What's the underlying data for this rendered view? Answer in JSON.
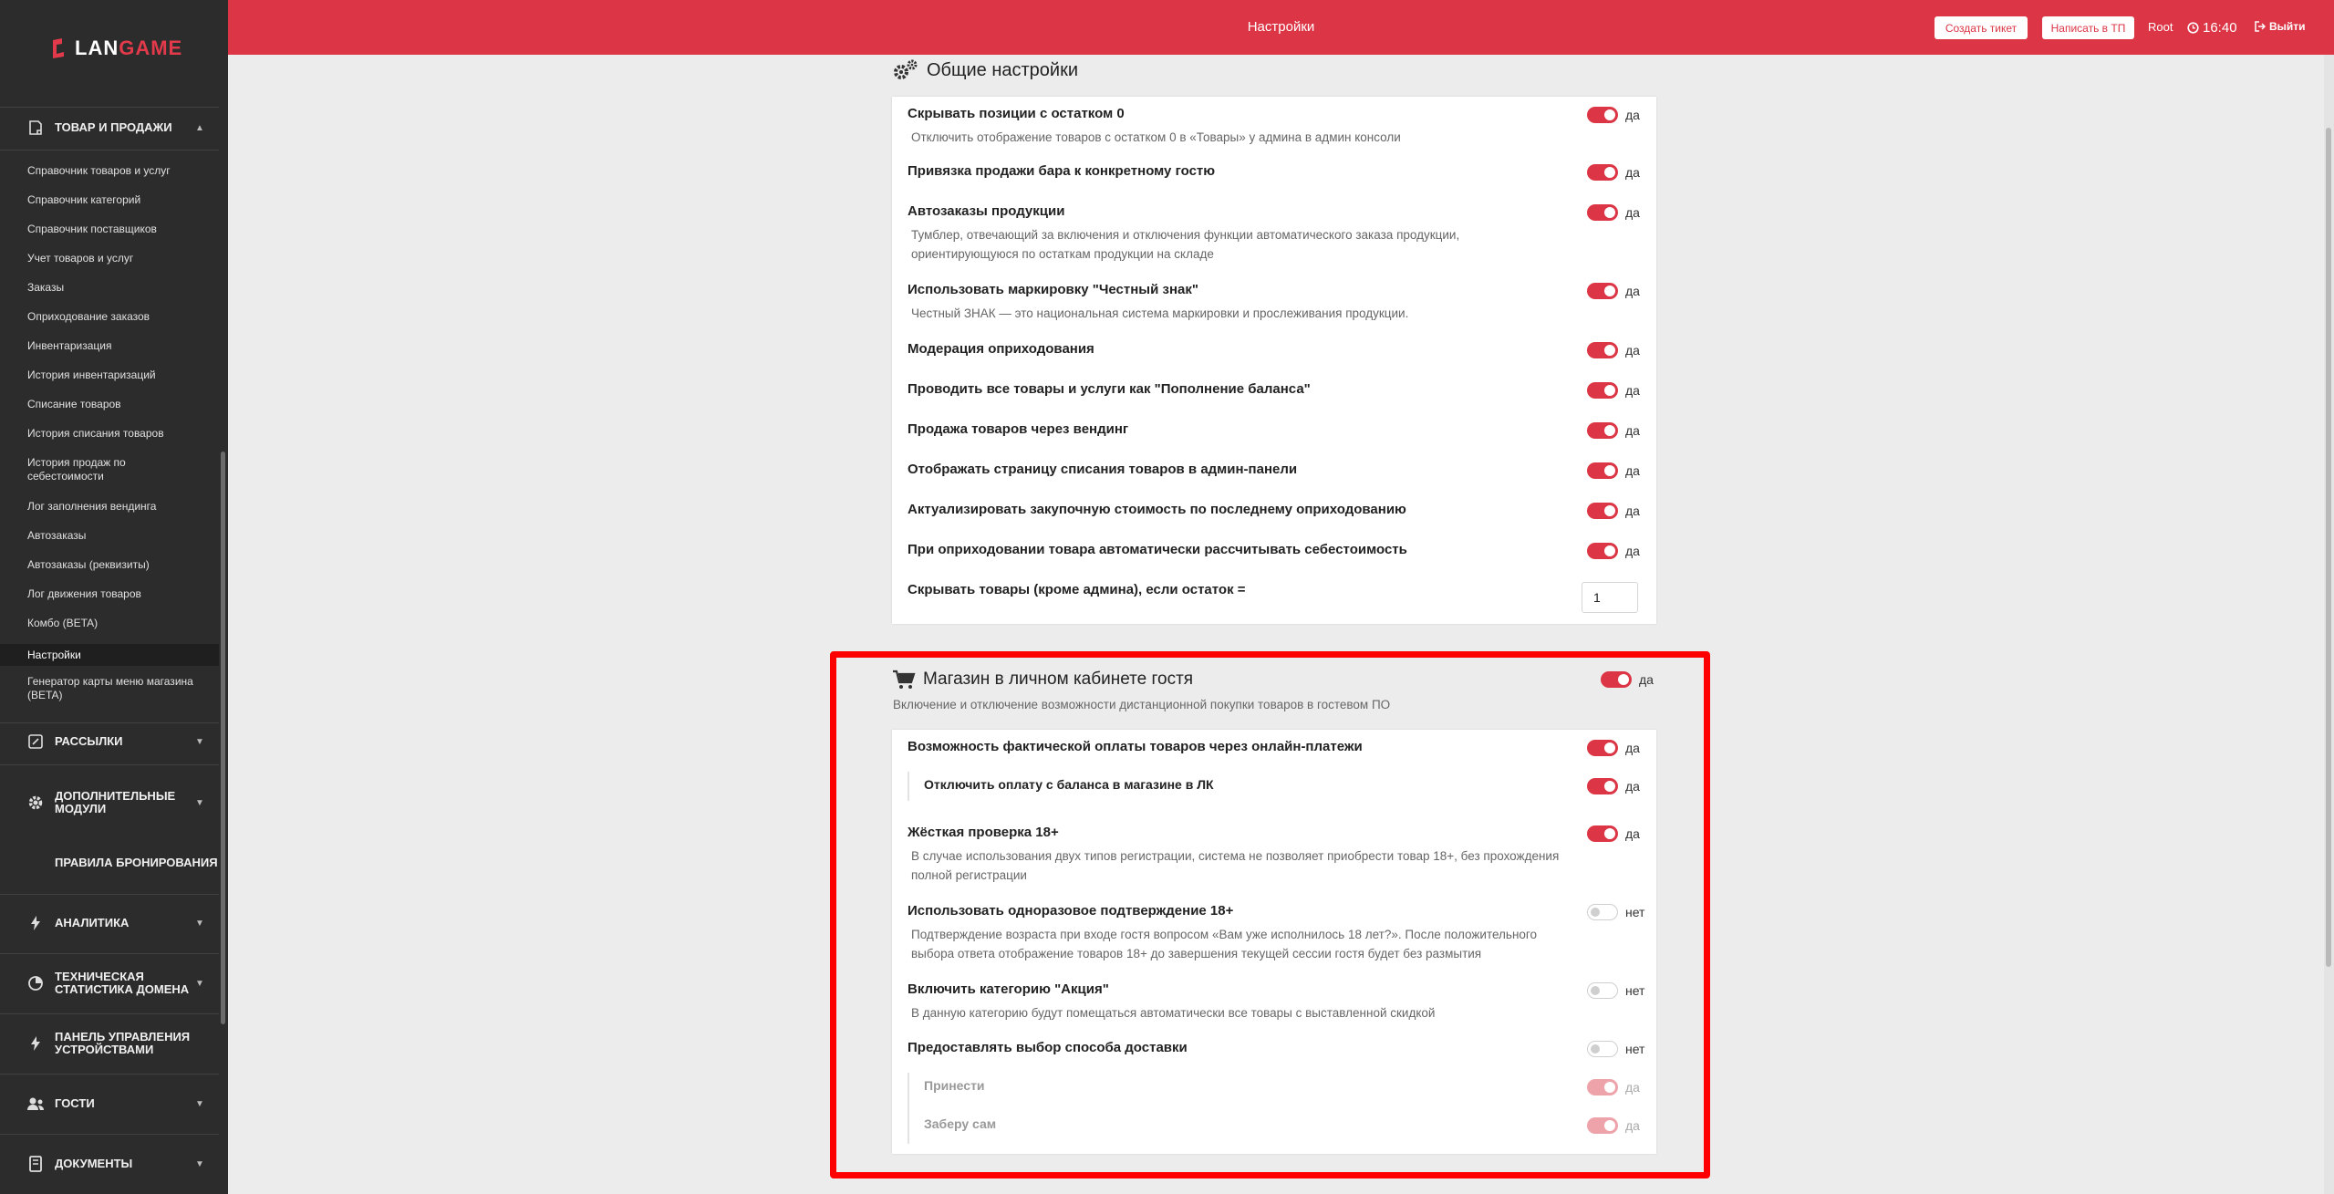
{
  "brand": {
    "name_part1": "LAN",
    "name_part2": "GAME",
    "accent": "#dc3545"
  },
  "header": {
    "title": "Настройки",
    "create_ticket": "Создать тикет",
    "write_support": "Написать в ТП",
    "user": "Root",
    "time": "16:40",
    "logout": "Выйти"
  },
  "sidebar": {
    "goods_section": "ТОВАР И ПРОДАЖИ",
    "goods_items": [
      "Справочник товаров и услуг",
      "Справочник категорий",
      "Справочник поставщиков",
      "Учет товаров и услуг",
      "Заказы",
      "Оприходование заказов",
      "Инвентаризация",
      "История инвентаризаций",
      "Списание товаров",
      "История списания товаров",
      "История продаж по себестоимости",
      "Лог заполнения вендинга",
      "Автозаказы",
      "Автозаказы (реквизиты)",
      "Лог движения товаров",
      "Комбо (BETA)",
      "Настройки",
      "Генератор карты меню магазина (BETA)"
    ],
    "mailings": "РАССЫЛКИ",
    "extra_modules": "ДОПОЛНИТЕЛЬНЫЕ МОДУЛИ",
    "booking_rules": "ПРАВИЛА БРОНИРОВАНИЯ",
    "analytics": "АНАЛИТИКА",
    "tech_stats": "ТЕХНИЧЕСКАЯ СТАТИСТИКА ДОМЕНА",
    "device_panel": "ПАНЕЛЬ УПРАВЛЕНИЯ УСТРОЙСТВАМИ",
    "guests": "ГОСТИ",
    "documents": "ДОКУМЕНТЫ"
  },
  "general": {
    "title": "Общие настройки",
    "rows": [
      {
        "title": "Скрывать позиции с остатком 0",
        "desc": "Отключить отображение товаров с остатком 0 в «Товары» у админа в админ консоли",
        "value": "да"
      },
      {
        "title": "Привязка продажи бара к конкретному гостю",
        "value": "да"
      },
      {
        "title": "Автозаказы продукции",
        "desc": "Тумблер, отвечающий за включения и отключения функции автоматического заказа продукции, ориентирующуюся по остаткам продукции на складе",
        "value": "да"
      },
      {
        "title": "Использовать маркировку \"Честный знак\"",
        "desc": "Честный ЗНАК — это национальная система маркировки и прослеживания продукции.",
        "value": "да"
      },
      {
        "title": "Модерация оприходования",
        "value": "да"
      },
      {
        "title": "Проводить все товары и услуги как \"Пополнение баланса\"",
        "value": "да"
      },
      {
        "title": "Продажа товаров через вендинг",
        "value": "да"
      },
      {
        "title": "Отображать страницу списания товаров в админ-панели",
        "value": "да"
      },
      {
        "title": "Актуализировать закупочную стоимость по последнему оприходованию",
        "value": "да"
      },
      {
        "title": "При оприходовании товара автоматически рассчитывать себестоимость",
        "value": "да"
      },
      {
        "title": "Скрывать товары (кроме админа), если остаток =",
        "input_value": "1"
      }
    ]
  },
  "shop": {
    "title": "Магазин в личном кабинете гостя",
    "desc": "Включение и отключение возможности дистанционной покупки товаров в гостевом ПО",
    "value": "да",
    "rows": [
      {
        "title": "Возможность фактической оплаты товаров через онлайн-платежи",
        "value": "да"
      },
      {
        "title": "Отключить оплату с баланса в магазине в ЛК",
        "value": "да"
      },
      {
        "title": "Жёсткая проверка 18+",
        "desc": "В случае использования двух типов регистрации, система не позволяет приобрести товар 18+, без прохождения полной регистрации",
        "value": "да"
      },
      {
        "title": "Использовать одноразовое подтверждение 18+",
        "desc": "Подтверждение возраста при входе гостя вопросом «Вам уже исполнилось 18 лет?». После положительного выбора ответа отображение товаров 18+ до завершения текущей сессии гостя будет без размытия",
        "value": "нет"
      },
      {
        "title": "Включить категорию \"Акция\"",
        "desc": "В данную категорию будут помещаться автоматически все товары с выставленной скидкой",
        "value": "нет"
      },
      {
        "title": "Предоставлять выбор способа доставки",
        "value": "нет"
      },
      {
        "title": "Принести",
        "value": "да"
      },
      {
        "title": "Заберу сам",
        "value": "да"
      }
    ]
  }
}
